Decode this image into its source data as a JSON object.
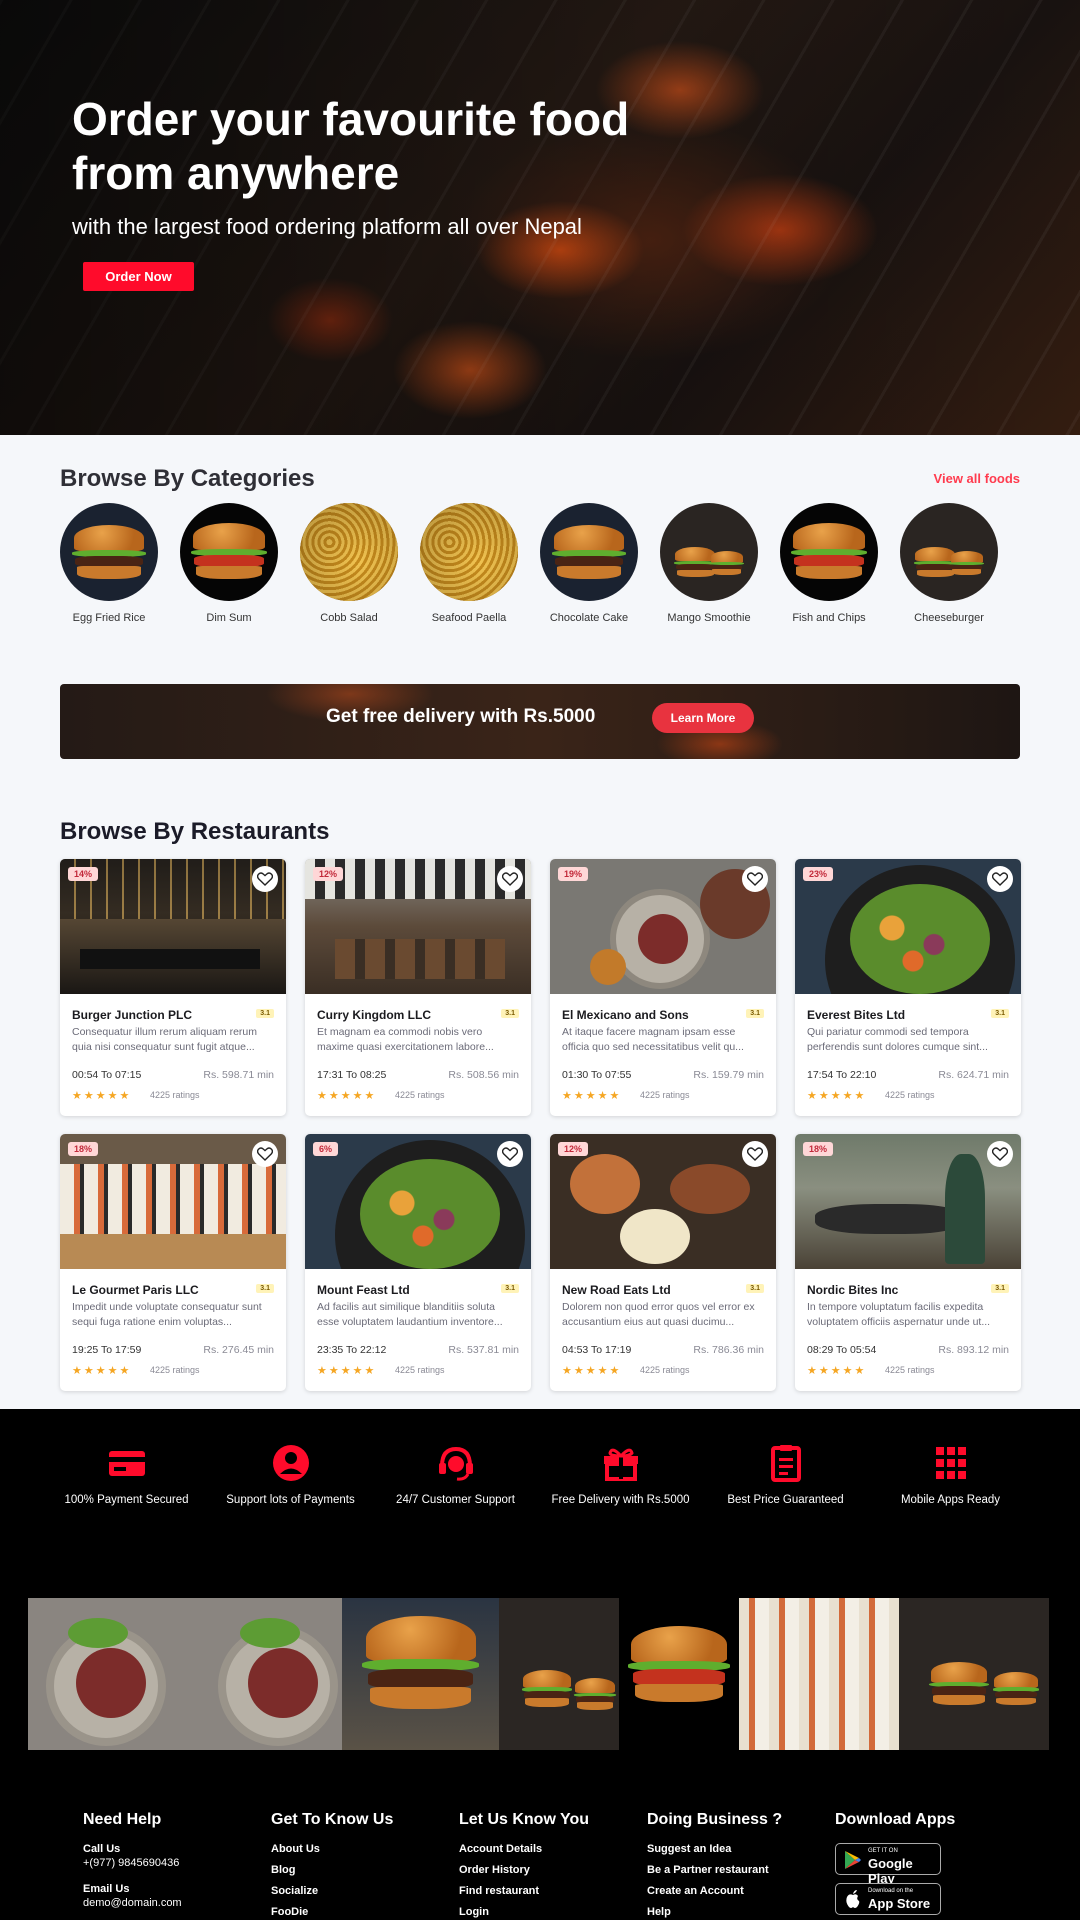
{
  "hero": {
    "title": "Order your favourite food from anywhere",
    "subtitle": "with the largest food ordering platform all over Nepal",
    "cta": "Order Now"
  },
  "categories": {
    "title": "Browse By Categories",
    "view_all": "View all foods",
    "items": [
      {
        "label": "Egg Fried Rice",
        "image": "burger"
      },
      {
        "label": "Dim Sum",
        "image": "burger"
      },
      {
        "label": "Cobb Salad",
        "image": "noodles"
      },
      {
        "label": "Seafood Paella",
        "image": "noodles"
      },
      {
        "label": "Chocolate Cake",
        "image": "burger"
      },
      {
        "label": "Mango Smoothie",
        "image": "burger-pair"
      },
      {
        "label": "Fish and Chips",
        "image": "burger"
      },
      {
        "label": "Cheeseburger",
        "image": "burger-pair"
      }
    ]
  },
  "promo": {
    "text": "Get free delivery with Rs.5000",
    "cta": "Learn More"
  },
  "restaurants": {
    "title": "Browse By Restaurants",
    "items": [
      {
        "name": "Burger Junction PLC",
        "discount": "14%",
        "rating": "3.1",
        "desc": "Consequatur illum rerum aliquam rerum quia nisi consequatur sunt fugit atque...",
        "time": "00:54 To 07:15",
        "price": "Rs. 598.71 min",
        "stars": "★★★★★",
        "ratings": "4225 ratings"
      },
      {
        "name": "Curry Kingdom LLC",
        "discount": "12%",
        "rating": "3.1",
        "desc": "Et magnam ea commodi nobis vero maxime quasi exercitationem labore...",
        "time": "17:31 To 08:25",
        "price": "Rs. 508.56 min",
        "stars": "★★★★★",
        "ratings": "4225 ratings"
      },
      {
        "name": "El Mexicano and Sons",
        "discount": "19%",
        "rating": "3.1",
        "desc": "At itaque facere magnam ipsam esse officia quo sed necessitatibus velit qu...",
        "time": "01:30 To 07:55",
        "price": "Rs. 159.79 min",
        "stars": "★★★★★",
        "ratings": "4225 ratings"
      },
      {
        "name": "Everest Bites Ltd",
        "discount": "23%",
        "rating": "3.1",
        "desc": "Qui pariatur commodi sed tempora perferendis sunt dolores cumque sint...",
        "time": "17:54 To 22:10",
        "price": "Rs. 624.71 min",
        "stars": "★★★★★",
        "ratings": "4225 ratings"
      },
      {
        "name": "Le Gourmet Paris LLC",
        "discount": "18%",
        "rating": "3.1",
        "desc": "Impedit unde voluptate consequatur sunt sequi fuga ratione enim voluptas...",
        "time": "19:25 To 17:59",
        "price": "Rs. 276.45 min",
        "stars": "★★★★★",
        "ratings": "4225 ratings"
      },
      {
        "name": "Mount Feast Ltd",
        "discount": "6%",
        "rating": "3.1",
        "desc": "Ad facilis aut similique blanditiis soluta esse voluptatem laudantium inventore...",
        "time": "23:35 To 22:12",
        "price": "Rs. 537.81 min",
        "stars": "★★★★★",
        "ratings": "4225 ratings"
      },
      {
        "name": "New Road Eats Ltd",
        "discount": "12%",
        "rating": "3.1",
        "desc": "Dolorem non quod error quos vel error ex accusantium eius aut quasi ducimu...",
        "time": "04:53 To 17:19",
        "price": "Rs. 786.36 min",
        "stars": "★★★★★",
        "ratings": "4225 ratings"
      },
      {
        "name": "Nordic Bites Inc",
        "discount": "18%",
        "rating": "3.1",
        "desc": "In tempore voluptatum facilis expedita voluptatem officiis aspernatur unde ut...",
        "time": "08:29 To 05:54",
        "price": "Rs. 893.12 min",
        "stars": "★★★★★",
        "ratings": "4225 ratings"
      }
    ]
  },
  "features": [
    {
      "label": "100% Payment Secured",
      "icon": "credit-card-icon"
    },
    {
      "label": "Support lots of Payments",
      "icon": "user-circle-icon"
    },
    {
      "label": "24/7 Customer Support",
      "icon": "headset-icon"
    },
    {
      "label": "Free Delivery with Rs.5000",
      "icon": "gift-icon"
    },
    {
      "label": "Best Price Guaranteed",
      "icon": "clipboard-icon"
    },
    {
      "label": "Mobile Apps Ready",
      "icon": "grid-icon"
    }
  ],
  "footer": {
    "need_help": {
      "title": "Need Help",
      "call_label": "Call Us",
      "phone": "+(977) 9845690436",
      "email_label": "Email Us",
      "email": "demo@domain.com"
    },
    "know_us": {
      "title": "Get To Know Us",
      "items": [
        "About Us",
        "Blog",
        "Socialize",
        "FooDie"
      ]
    },
    "let_us_know": {
      "title": "Let Us Know You",
      "items": [
        "Account Details",
        "Order History",
        "Find restaurant",
        "Login"
      ]
    },
    "business": {
      "title": "Doing Business ?",
      "items": [
        "Suggest an Idea",
        "Be a Partner restaurant",
        "Create an Account",
        "Help"
      ]
    },
    "apps": {
      "title": "Download Apps",
      "google_small": "GET IT ON",
      "google_big": "Google Play",
      "apple_small": "Download on the",
      "apple_big": "App Store"
    }
  },
  "colors": {
    "accent": "#ff0b2b",
    "dark": "#000000"
  }
}
